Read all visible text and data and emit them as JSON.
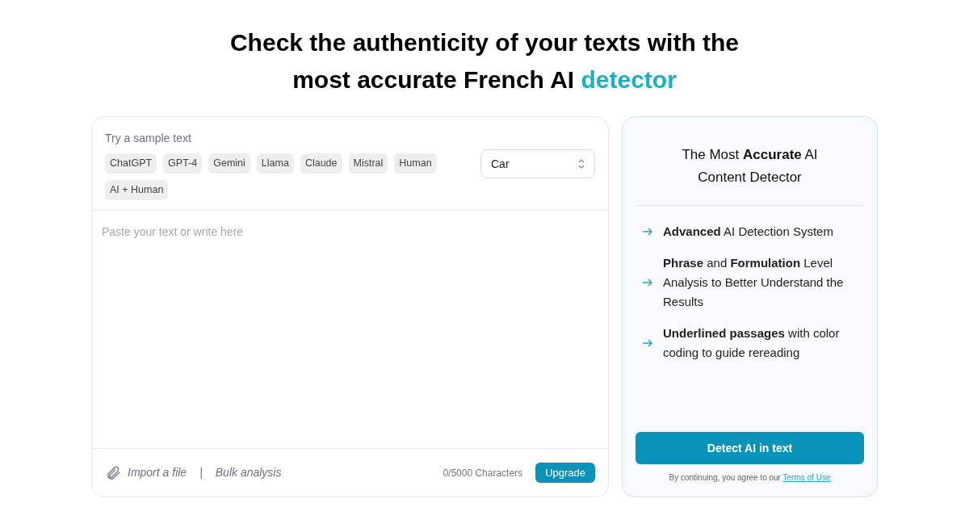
{
  "headline": {
    "line_1": [
      {
        "text": "Check the authenticity of your texts with the",
        "highlight": false
      }
    ],
    "line_2": [
      {
        "text": "most accurate French AI ",
        "highlight": false
      },
      {
        "text": "detector",
        "highlight": true
      }
    ]
  },
  "editor": {
    "sample_label": "Try a sample text",
    "samples": [
      "ChatGPT",
      "GPT-4",
      "Gemini",
      "Llama",
      "Claude",
      "Mistral",
      "Human",
      "AI + Human"
    ],
    "select": {
      "value": "Car"
    },
    "placeholder": "Paste your text or write here",
    "import_label": "Import a file",
    "separator": "|",
    "bulk_label": "Bulk analysis",
    "counter": "0/5000 Characters",
    "upgrade_button": "Upgrade"
  },
  "sidebar": {
    "title": "The Most **Accurate** AI Content Detector",
    "features": [
      "**Advanced** AI Detection System",
      "**Phrase** and **Formulation** Level Analysis to Better Understand the Results",
      "**Underlined passages** with color coding to guide rereading"
    ],
    "detect_button": "Detect AI in text",
    "terms_prefix": "By continuing, you agree to our ",
    "terms_link": "Terms of Use"
  }
}
